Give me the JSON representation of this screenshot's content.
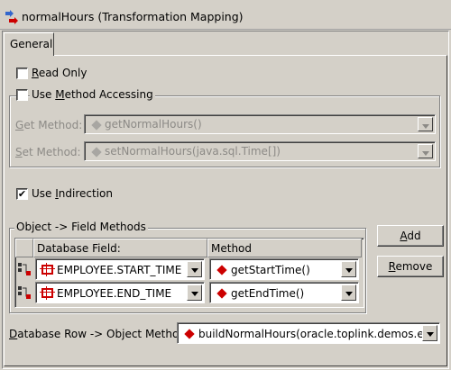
{
  "window": {
    "title": "normalHours (Transformation Mapping)"
  },
  "tabs": [
    {
      "label": "General",
      "selected": true
    }
  ],
  "options": {
    "read_only": {
      "label": "Read Only",
      "checked": false
    },
    "use_method_accessing": {
      "label": "Use Method Accessing",
      "checked": false
    },
    "use_indirection": {
      "label": "Use Indirection",
      "checked": true
    }
  },
  "method_accessing": {
    "get_method": {
      "label": "Get Method:",
      "value": "getNormalHours()",
      "enabled": false
    },
    "set_method": {
      "label": "Set Method:",
      "value": "setNormalHours(java.sql.Time[])",
      "enabled": false
    }
  },
  "field_methods": {
    "group_label": "Object -> Field Methods",
    "columns": [
      "Database Field:",
      "Method"
    ],
    "rows": [
      {
        "field": "EMPLOYEE.START_TIME",
        "method": "getStartTime()"
      },
      {
        "field": "EMPLOYEE.END_TIME",
        "method": "getEndTime()"
      }
    ],
    "add_label": "Add",
    "remove_label": "Remove"
  },
  "row_to_object": {
    "label": "Database Row -> Object Method:",
    "value": "buildNormalHours(oracle.toplink.demos.e...."
  },
  "colors": {
    "background": "#d4d0c8",
    "disabled_text": "#8c8a86",
    "accent_red": "#cc0000"
  }
}
